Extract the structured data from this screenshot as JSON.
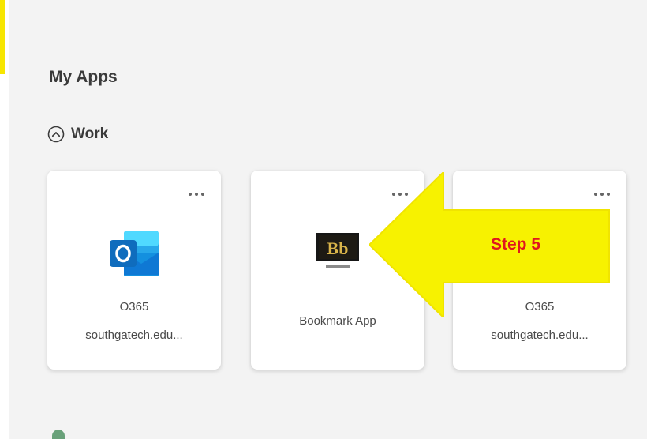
{
  "page": {
    "section_title": "My Apps",
    "group": {
      "label": "Work",
      "icon": "chevron-up-circle-icon",
      "state": "expanded"
    }
  },
  "apps": [
    {
      "name": "O365",
      "subtitle": "southgatech.edu...",
      "icon": "outlook-icon"
    },
    {
      "name": "Bookmark App",
      "subtitle": "",
      "icon": "blackboard-icon"
    },
    {
      "name": "O365",
      "subtitle": "southgatech.edu...",
      "icon": "outlook-icon"
    }
  ],
  "annotation": {
    "label": "Step 5",
    "arrow_color": "#f7f200",
    "label_color": "#e0161e"
  },
  "colors": {
    "background": "#f3f3f3",
    "tile": "#ffffff",
    "outlook_blue": "#0f6cbd"
  }
}
